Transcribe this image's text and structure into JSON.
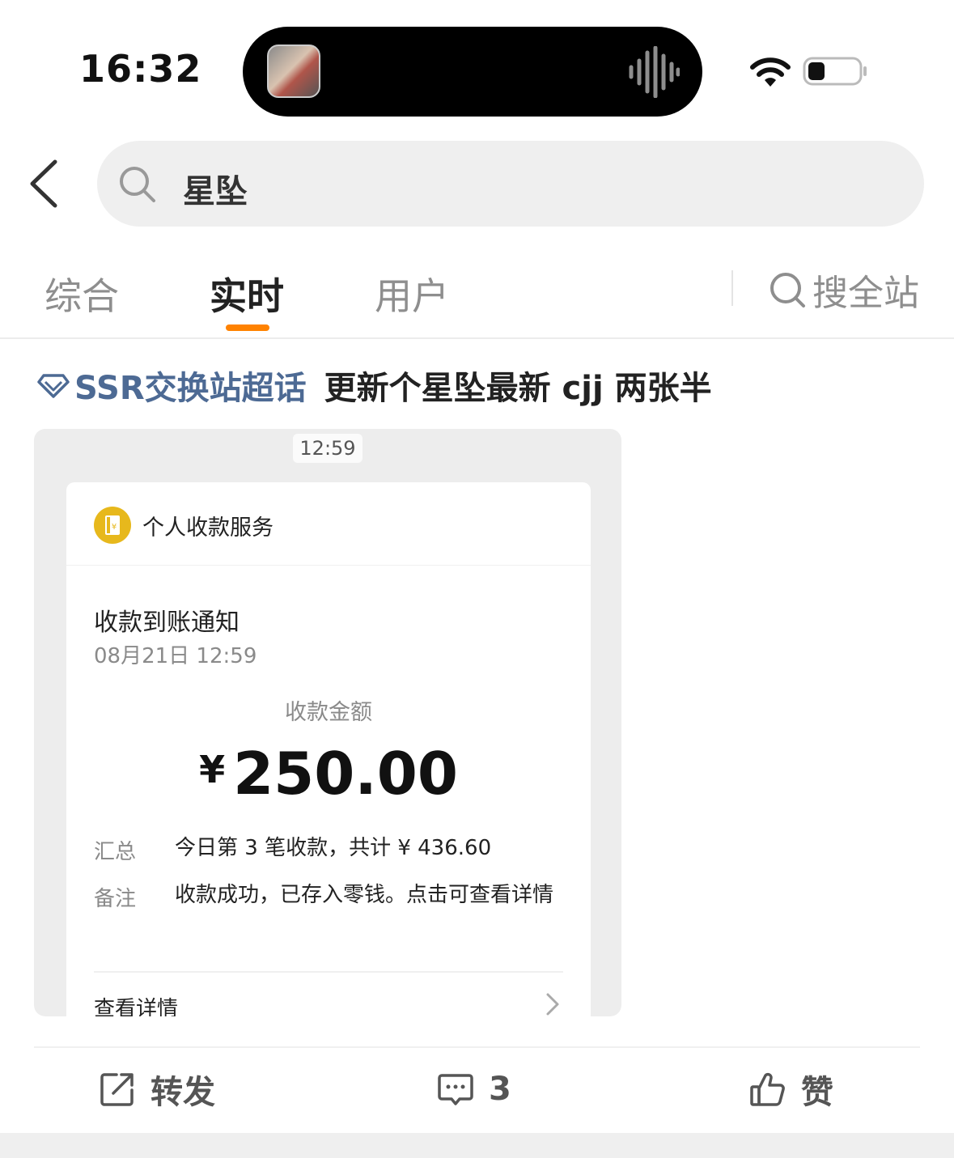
{
  "status_bar": {
    "time": "16:32"
  },
  "search": {
    "query": "星坠"
  },
  "tabs": [
    {
      "label": "综合"
    },
    {
      "label": "实时"
    },
    {
      "label": "用户"
    }
  ],
  "search_all_label": "搜全站",
  "post": {
    "topic": "SSR交换站超话",
    "text": "更新个星坠最新 cjj 两张半",
    "image": {
      "time": "12:59",
      "service_name": "个人收款服务",
      "notice_title": "收款到账通知",
      "notice_date": "08月21日 12:59",
      "amount_label": "收款金额",
      "currency": "¥",
      "amount": "250.00",
      "summary_label": "汇总",
      "summary_value": "今日第 3 笔收款，共计 ¥ 436.60",
      "note_label": "备注",
      "note_value": "收款成功，已存入零钱。点击可查看详情",
      "detail_label": "查看详情"
    }
  },
  "actions": {
    "repost_label": "转发",
    "comment_count": "3",
    "like_label": "赞"
  },
  "colors": {
    "accent": "#ff8200",
    "topic": "#4d6a94",
    "service_icon": "#e7b81c"
  }
}
